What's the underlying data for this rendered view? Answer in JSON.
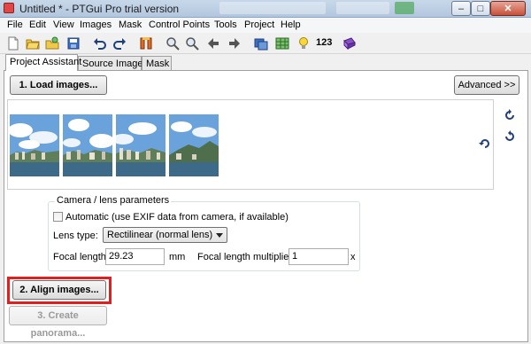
{
  "window": {
    "title": "Untitled * - PTGui Pro trial version",
    "minimize_glyph": "‒",
    "maximize_glyph": "□",
    "close_glyph": "✕"
  },
  "menu": [
    "File",
    "Edit",
    "View",
    "Images",
    "Mask",
    "Control Points",
    "Tools",
    "Project",
    "Help"
  ],
  "toolbar": {
    "icons": [
      "new-file-icon",
      "open-folder-icon",
      "open-recent-icon",
      "save-icon",
      "undo-icon",
      "redo-icon",
      "control-points-icon",
      "zoom-in-icon",
      "zoom-out-icon",
      "previous-icon",
      "next-icon",
      "panorama-editor-icon",
      "table-icon",
      "tips-bulb-icon",
      "numbering-label",
      "batch-icon"
    ],
    "numbering_label": "123"
  },
  "tabs": [
    {
      "label": "Project Assistant",
      "active": true
    },
    {
      "label": "Source Images",
      "active": false
    },
    {
      "label": "Mask",
      "active": false
    }
  ],
  "buttons": {
    "load_images": "1. Load images...",
    "advanced": "Advanced >>",
    "align_images": "2. Align images...",
    "create_panorama": "3. Create panorama..."
  },
  "images": {
    "count": 4,
    "rotate_icons": [
      "rotate-clockwise-icon",
      "rotate-counterclockwise-icon",
      "rotate-icon"
    ]
  },
  "camera": {
    "group_title": "Camera / lens parameters",
    "automatic_label": "Automatic (use EXIF data from camera, if available)",
    "automatic_checked": false,
    "lens_type_label": "Lens type:",
    "lens_type_value": "Rectilinear (normal lens)",
    "focal_length_label": "Focal length:",
    "focal_length_value": "29.23",
    "focal_length_unit": "mm",
    "multiplier_label": "Focal length multiplier:",
    "multiplier_value": "1",
    "multiplier_unit": "x"
  },
  "colors": {
    "highlight": "#e02020",
    "sky": "#6aa2dc",
    "water": "#3d6a88"
  }
}
